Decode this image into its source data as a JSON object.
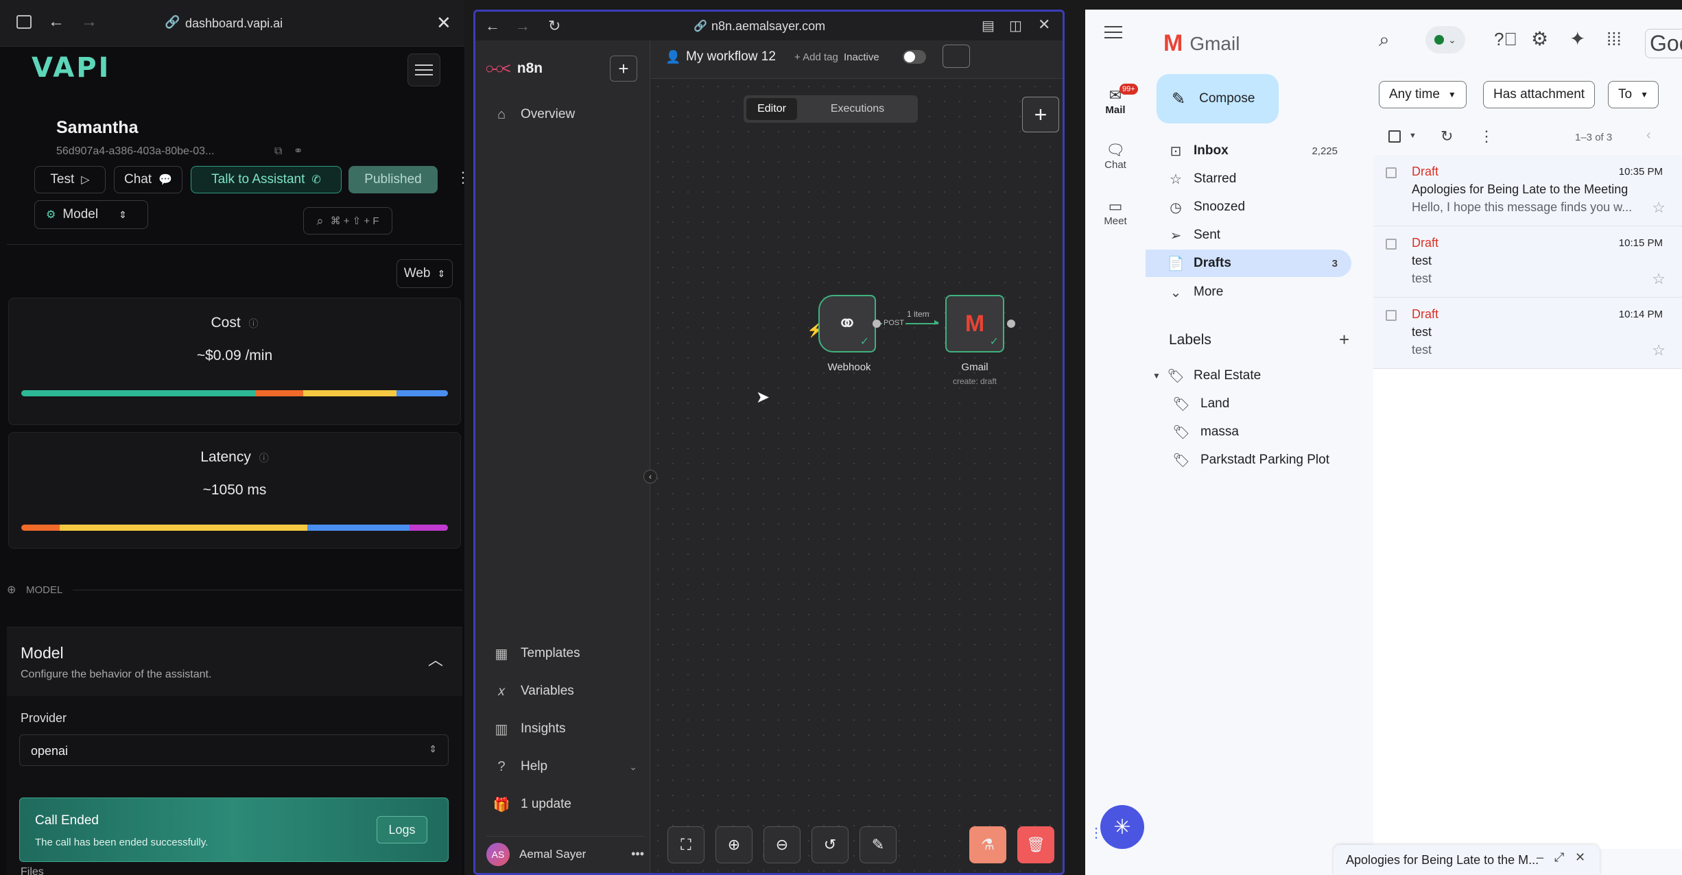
{
  "vapi": {
    "url": "dashboard.vapi.ai",
    "logo": "VAPI",
    "assistant_name": "Samantha",
    "assistant_id": "56d907a4-a386-403a-80be-03...",
    "test_label": "Test",
    "chat_label": "Chat",
    "talk_label": "Talk to Assistant",
    "published_label": "Published",
    "model_tab": "Model",
    "search_hint": "⌘ + ⇧ + F",
    "web_select": "Web",
    "cost_title": "Cost",
    "cost_value": "~$0.09 /min",
    "cost_bar": {
      "segments": [
        0.55,
        0.11,
        0.22,
        0.12
      ],
      "colors": [
        "#2db896",
        "#f06a2a",
        "#f5c842",
        "#4a8ef0"
      ]
    },
    "latency_title": "Latency",
    "latency_value": "~1050 ms",
    "latency_bar": {
      "segments": [
        0.09,
        0.58,
        0.24,
        0.09
      ],
      "colors": [
        "#f06a2a",
        "#f5c842",
        "#4a8ef0",
        "#c03ad0"
      ]
    },
    "section_label": "MODEL",
    "model_title": "Model",
    "model_desc": "Configure the behavior of the assistant.",
    "provider_label": "Provider",
    "provider_value": "openai",
    "toast_title": "Call Ended",
    "toast_desc": "The call has been ended successfully.",
    "toast_logs": "Logs",
    "files_label": "Files"
  },
  "n8n": {
    "url": "n8n.aemalsayer.com",
    "brand": "n8n",
    "overview": "Overview",
    "workflow_name": "My workflow 12",
    "add_tag": "+ Add tag",
    "inactive": "Inactive",
    "tab_editor": "Editor",
    "tab_executions": "Executions",
    "node_webhook": "Webhook",
    "node_gmail": "Gmail",
    "node_gmail_sub": "create: draft",
    "conn_items": "1 item",
    "conn_method": "POST",
    "templates": "Templates",
    "variables": "Variables",
    "insights": "Insights",
    "help": "Help",
    "update": "1 update",
    "user_initials": "AS",
    "user_name": "Aemal Sayer"
  },
  "gmail": {
    "brand": "Gmail",
    "compose": "Compose",
    "rail_mail": "Mail",
    "rail_badge": "99+",
    "rail_chat": "Chat",
    "rail_meet": "Meet",
    "chip_anytime": "Any time",
    "chip_attachment": "Has attachment",
    "chip_to": "To",
    "range": "1–3 of 3",
    "inbox": "Inbox",
    "inbox_count": "2,225",
    "starred": "Starred",
    "snoozed": "Snoozed",
    "sent": "Sent",
    "drafts": "Drafts",
    "drafts_count": "3",
    "more": "More",
    "labels_title": "Labels",
    "label_real_estate": "Real Estate",
    "label_land": "Land",
    "label_massa": "massa",
    "label_parkstadt": "Parkstadt Parking Plot",
    "messages": [
      {
        "tag": "Draft",
        "time": "10:35 PM",
        "subject": "Apologies for Being Late to the Meeting",
        "snippet": "Hello, I hope this message finds you w..."
      },
      {
        "tag": "Draft",
        "time": "10:15 PM",
        "subject": "test",
        "snippet": "test"
      },
      {
        "tag": "Draft",
        "time": "10:14 PM",
        "subject": "test",
        "snippet": "test"
      }
    ],
    "compose_popup_title": "Apologies for Being Late to the M...",
    "google_partial": "Goo"
  }
}
